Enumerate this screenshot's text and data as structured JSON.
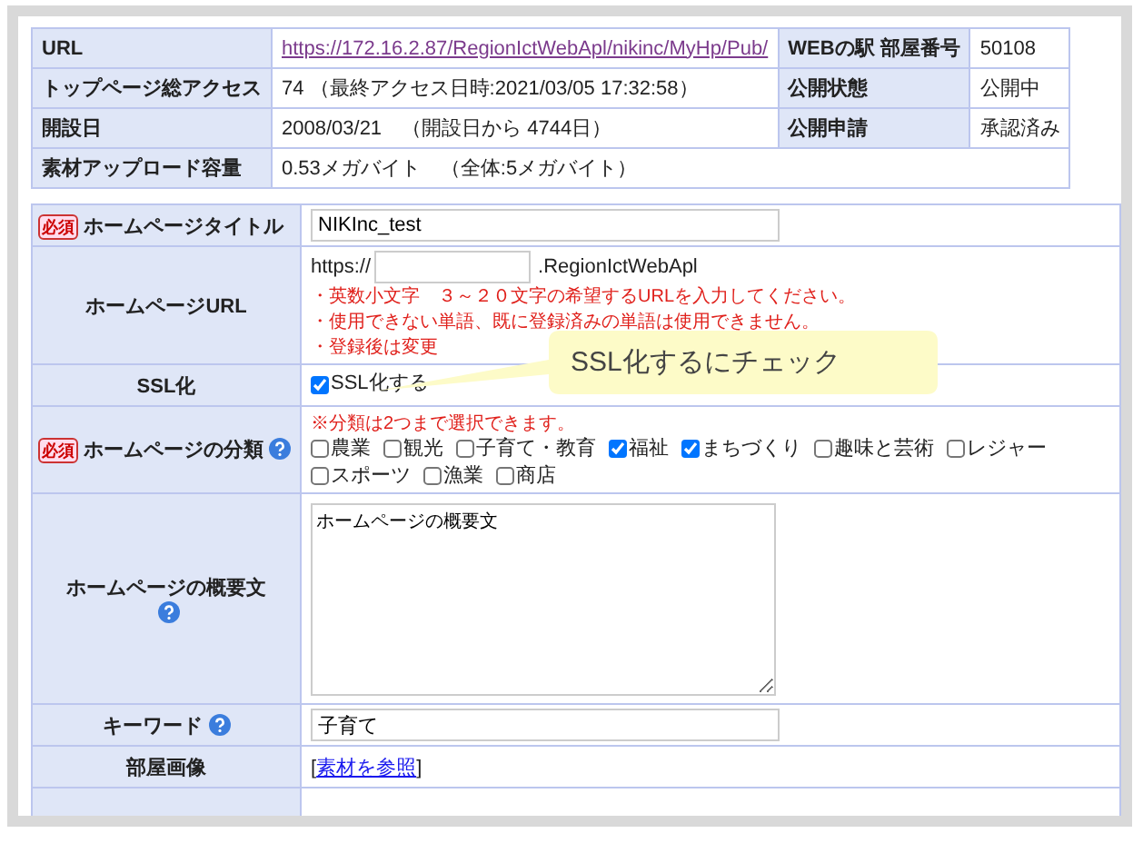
{
  "info_table": {
    "rows": [
      {
        "label": "URL",
        "link": "https://172.16.2.87/RegionIctWebApl/nikinc/MyHp/Pub/",
        "label2": "WEBの駅 部屋番号",
        "value2": "50108"
      },
      {
        "label": "トップページ総アクセス",
        "value": "74 （最終アクセス日時:2021/03/05 17:32:58）",
        "label2": "公開状態",
        "value2": "公開中"
      },
      {
        "label": "開設日",
        "value": "2008/03/21　（開設日から 4744日）",
        "label2": "公開申請",
        "value2": "承認済み"
      },
      {
        "label": "素材アップロード容量",
        "value": "0.53メガバイト　（全体:5メガバイト）"
      }
    ]
  },
  "form": {
    "rows": [
      {
        "kind": "text",
        "label": "ホームページタイトル",
        "required": true,
        "required_badge": "必須",
        "help": false,
        "value": "NIKInc_test"
      },
      {
        "kind": "url",
        "label": "ホームページURL",
        "required": false,
        "help": false,
        "prefix": "https://",
        "suffix": ".RegionIctWebApl",
        "notes": [
          "・英数小文字　３～２０文字の希望するURLを入力してください。",
          "・使用できない単語、既に登録済みの単語は使用できません。",
          "・登録後は変更"
        ]
      },
      {
        "kind": "checkbox",
        "label": "SSL化",
        "required": false,
        "help": false,
        "option": {
          "label": "SSL化する",
          "checked": true
        }
      },
      {
        "kind": "categories",
        "label": "ホームページの分類",
        "required": true,
        "required_badge": "必須",
        "help": true,
        "note": "※分類は2つまで選択できます。",
        "options": [
          {
            "label": "農業",
            "checked": false
          },
          {
            "label": "観光",
            "checked": false
          },
          {
            "label": "子育て・教育",
            "checked": false
          },
          {
            "label": "福祉",
            "checked": true
          },
          {
            "label": "まちづくり",
            "checked": true
          },
          {
            "label": "趣味と芸術",
            "checked": false
          },
          {
            "label": "レジャー",
            "checked": false
          },
          {
            "label": "スポーツ",
            "checked": false
          },
          {
            "label": "漁業",
            "checked": false
          },
          {
            "label": "商店",
            "checked": false
          }
        ]
      },
      {
        "kind": "textarea",
        "label": "ホームページの概要文",
        "required": false,
        "help": true,
        "value": "ホームページの概要文"
      },
      {
        "kind": "text",
        "label": "キーワード",
        "required": false,
        "help": true,
        "value": "子育て"
      },
      {
        "kind": "link",
        "label": "部屋画像",
        "required": false,
        "help": false,
        "open": "[",
        "link": "素材を参照",
        "close": "]"
      },
      {
        "kind": "empty"
      }
    ]
  },
  "callout": {
    "text": "SSL化するにチェック"
  }
}
